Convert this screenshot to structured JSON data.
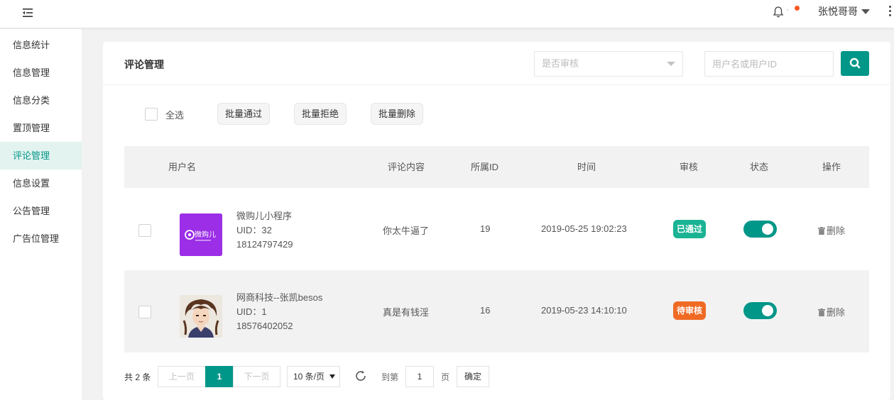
{
  "header": {
    "user_name": "张悦哥哥"
  },
  "sidebar": {
    "items": [
      {
        "label": "信息统计"
      },
      {
        "label": "信息管理"
      },
      {
        "label": "信息分类"
      },
      {
        "label": "置顶管理"
      },
      {
        "label": "评论管理",
        "active": true
      },
      {
        "label": "信息设置"
      },
      {
        "label": "公告管理"
      },
      {
        "label": "广告位管理"
      }
    ]
  },
  "card": {
    "title": "评论管理",
    "filter_placeholder": "是否审核",
    "search_placeholder": "用户名或用户ID"
  },
  "toolbar": {
    "select_all": "全选",
    "batch_approve": "批量通过",
    "batch_reject": "批量拒绝",
    "batch_delete": "批量删除"
  },
  "table": {
    "columns": {
      "username": "用户名",
      "content": "评论内容",
      "ref_id": "所属ID",
      "time": "时间",
      "review": "审核",
      "status": "状态",
      "action": "操作"
    },
    "rows": [
      {
        "name": "微购儿小程序",
        "uid": "UID：32",
        "phone": "18124797429",
        "content": "你太牛逼了",
        "ref_id": "19",
        "time": "2019-05-25 19:02:23",
        "review": "已通过",
        "review_color": "#1ab394",
        "status_on": true,
        "action": "删除",
        "avatar_logo_text": "微购儿"
      },
      {
        "name": "网商科技--张凯besos",
        "uid": "UID：1",
        "phone": "18576402052",
        "content": "真是有钱淫",
        "ref_id": "16",
        "time": "2019-05-23 14:10:10",
        "review": "待审核",
        "review_color": "#f06a24",
        "status_on": true,
        "action": "删除"
      }
    ]
  },
  "pager": {
    "total": "共 2 条",
    "prev": "上一页",
    "current": "1",
    "next": "下一页",
    "size": "10 条/页",
    "goto": "到第",
    "goto_value": "1",
    "page_unit": "页",
    "confirm": "确定"
  },
  "colors": {
    "accent": "#009688",
    "active_bg": "#e3f3ef",
    "approved": "#1ab394",
    "pending": "#f06a24",
    "notify_dot": "#ff5722"
  },
  "icons": [
    "menu-fold-icon",
    "bell-icon",
    "caret-down-icon",
    "more-vertical-icon",
    "search-icon",
    "trash-icon",
    "refresh-icon"
  ]
}
